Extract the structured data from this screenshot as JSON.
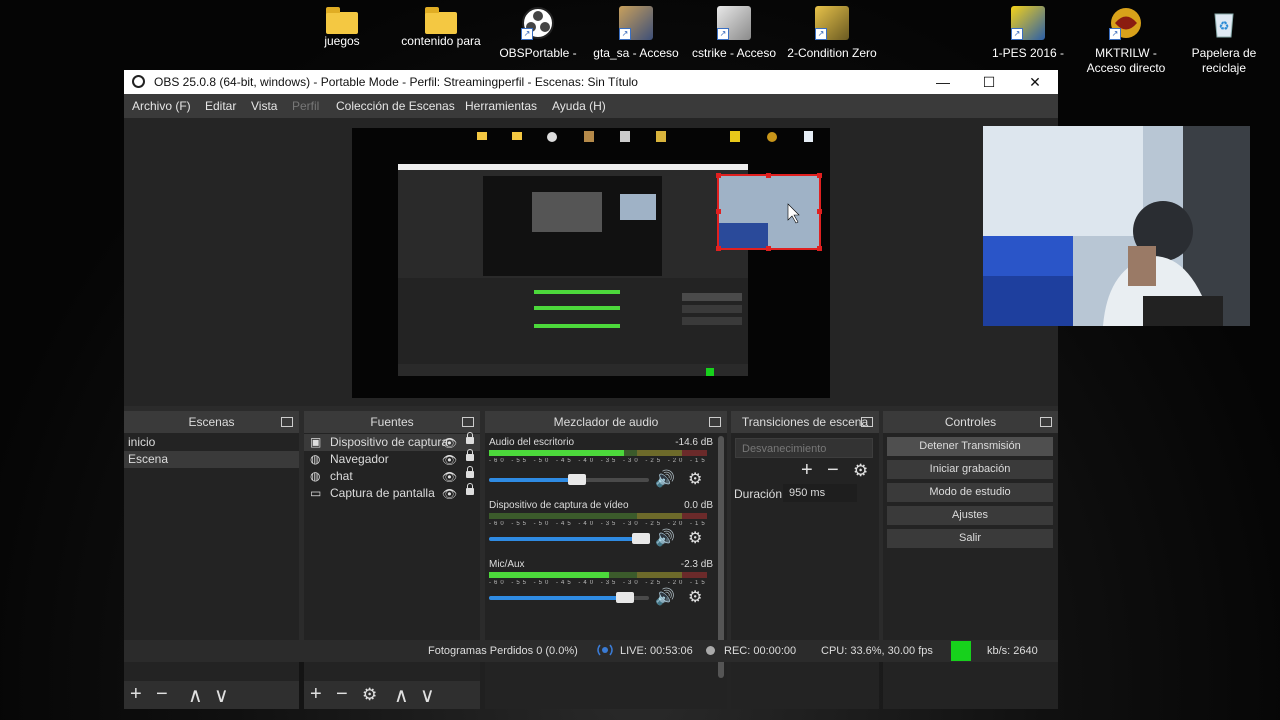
{
  "desktop": {
    "icons": [
      {
        "label": "juegos",
        "icon": "folder-icon"
      },
      {
        "label": "contenido para",
        "icon": "folder-icon"
      },
      {
        "label": "OBSPortable -",
        "icon": "obs-icon"
      },
      {
        "label": "gta_sa - Acceso",
        "icon": "gta-icon"
      },
      {
        "label": "cstrike - Acceso",
        "icon": "counter-strike-icon"
      },
      {
        "label": "2-Condition Zero",
        "icon": "condition-zero-icon"
      },
      {
        "label": "1-PES 2016 -",
        "icon": "pes-icon"
      },
      {
        "label": "MKTRILW -",
        "label2": "Acceso directo",
        "icon": "mortal-kombat-icon"
      },
      {
        "label": "Papelera de",
        "label2": "reciclaje",
        "icon": "recycle-bin-icon"
      }
    ]
  },
  "window": {
    "title": "OBS 25.0.8 (64-bit, windows) - Portable Mode - Perfil: Streamingperfil - Escenas: Sin Título",
    "minimize": "—",
    "maximize": "☐",
    "close": "✕"
  },
  "menu": [
    "Archivo (F)",
    "Editar",
    "Vista",
    "Perfil",
    "Colección de Escenas",
    "Herramientas",
    "Ayuda (H)"
  ],
  "scenes": {
    "title": "Escenas",
    "items": [
      "inicio",
      "Escena"
    ],
    "selected": 1
  },
  "sources": {
    "title": "Fuentes",
    "items": [
      {
        "name": "Dispositivo de captura",
        "icon": "camera-icon"
      },
      {
        "name": "Navegador",
        "icon": "globe-icon"
      },
      {
        "name": "chat",
        "icon": "globe-icon"
      },
      {
        "name": "Captura de pantalla",
        "icon": "monitor-icon"
      }
    ]
  },
  "mixer": {
    "title": "Mezclador de audio",
    "ticks": "-60 -55 -50 -45 -40 -35 -30 -25 -20 -15 -10 -5 0",
    "channels": [
      {
        "name": "Audio del escritorio",
        "db": "-14.6 dB",
        "level": 0.62,
        "volume": 0.55
      },
      {
        "name": "Dispositivo de captura de vídeo",
        "db": "0.0 dB",
        "level": 0.0,
        "volume": 0.95
      },
      {
        "name": "Mic/Aux",
        "db": "-2.3 dB",
        "level": 0.55,
        "volume": 0.85
      }
    ]
  },
  "transitions": {
    "title": "Transiciones de escena",
    "type": "Desvanecimiento",
    "duration_label": "Duración",
    "duration": "950 ms"
  },
  "controls": {
    "title": "Controles",
    "buttons": [
      "Detener Transmisión",
      "Iniciar grabación",
      "Modo de estudio",
      "Ajustes",
      "Salir"
    ]
  },
  "status": {
    "dropped": "Fotogramas Perdidos 0 (0.0%)",
    "live": "LIVE: 00:53:06",
    "rec": "REC: 00:00:00",
    "cpu": "CPU: 33.6%, 30.00 fps",
    "kbs": "kb/s: 2640",
    "health_color": "#17d11c"
  },
  "icons": {
    "add": "+",
    "remove": "−",
    "up": "∧",
    "down": "∨",
    "gear": "⚙"
  }
}
